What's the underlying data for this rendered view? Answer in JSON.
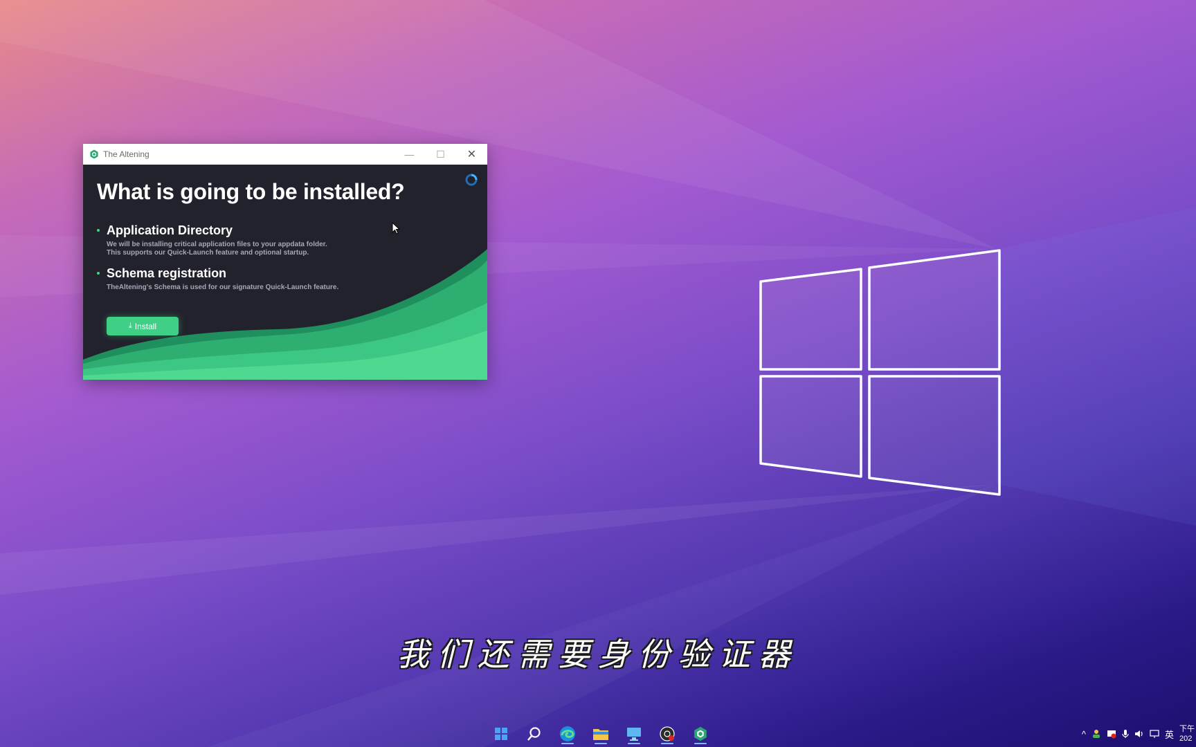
{
  "window": {
    "title": "The Altening",
    "minimize_glyph": "—",
    "maximize_glyph": "☐",
    "close_glyph": "✕"
  },
  "installer": {
    "heading": "What is going to be installed?",
    "sections": [
      {
        "title": "Application Directory",
        "description_line1": "We will be installing critical application files to your appdata folder.",
        "description_line2": "This supports our Quick-Launch feature and optional startup."
      },
      {
        "title": "Schema registration",
        "description_line1": "TheAltening's Schema is used for our signature Quick-Launch feature."
      }
    ],
    "install_label": "Install",
    "install_icon": "download-icon",
    "accent_color": "#3fcf86"
  },
  "subtitle": "我们还需要身份验证器",
  "taskbar": {
    "icons": [
      "start-icon",
      "search-icon",
      "edge-icon",
      "file-explorer-icon",
      "remote-desktop-icon",
      "recorder-icon",
      "altening-icon"
    ]
  },
  "tray": {
    "chevron": "^",
    "ime": "英",
    "clock_line1": "下午",
    "clock_line2": "202"
  }
}
